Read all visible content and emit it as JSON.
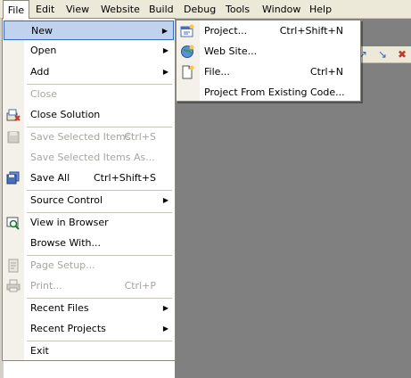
{
  "menubar": {
    "file": "File",
    "edit": "Edit",
    "view": "View",
    "website": "Website",
    "build": "Build",
    "debug": "Debug",
    "tools": "Tools",
    "window": "Window",
    "help": "Help"
  },
  "file_menu": {
    "new": "New",
    "open": "Open",
    "add": "Add",
    "close": "Close",
    "close_solution": "Close Solution",
    "save_selected_items": "Save Selected Items",
    "save_selected_items_shortcut": "Ctrl+S",
    "save_selected_items_as": "Save Selected Items As...",
    "save_all": "Save All",
    "save_all_shortcut": "Ctrl+Shift+S",
    "source_control": "Source Control",
    "view_in_browser": "View in Browser",
    "browse_with": "Browse With...",
    "page_setup": "Page Setup...",
    "print": "Print...",
    "print_shortcut": "Ctrl+P",
    "recent_files": "Recent Files",
    "recent_projects": "Recent Projects",
    "exit": "Exit"
  },
  "new_submenu": {
    "project": "Project...",
    "project_shortcut": "Ctrl+Shift+N",
    "web_site": "Web Site...",
    "file": "File...",
    "file_shortcut": "Ctrl+N",
    "project_from_existing_code": "Project From Existing Code..."
  },
  "colors": {
    "menubar_bg": "#ece9d8",
    "menu_gutter": "#f3f1ea",
    "highlight_bg": "#c1d2ee",
    "highlight_border": "#316ac5",
    "workspace_bg": "#808080",
    "disabled_text": "#a7a59e"
  },
  "icons": {
    "close_solution": "close-solution-icon",
    "save_selected": "save-icon",
    "save_all": "save-all-icon",
    "view_in_browser": "view-in-browser-icon",
    "page_setup": "page-setup-icon",
    "print": "print-icon",
    "project": "new-project-icon",
    "web_site": "web-site-icon",
    "file": "new-file-icon"
  }
}
